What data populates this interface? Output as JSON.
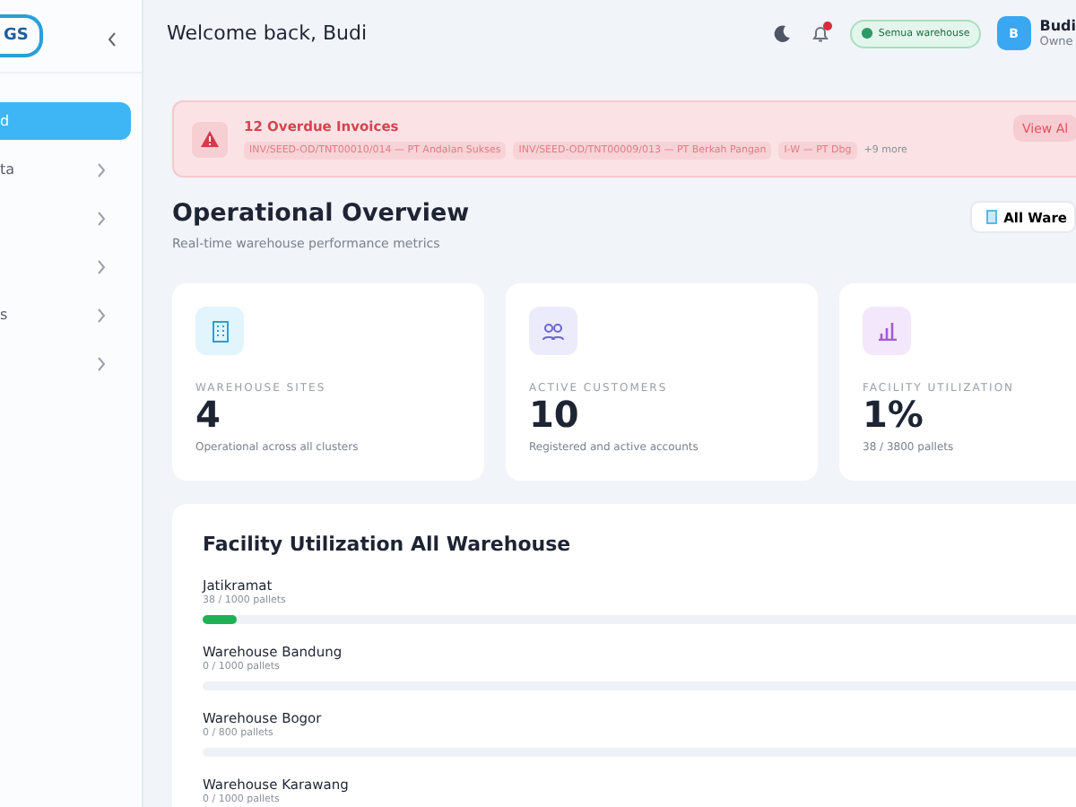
{
  "sidebar": {
    "logo": "GS",
    "items": [
      {
        "label": "d",
        "selected": true,
        "has_submenu": false
      },
      {
        "label": "ta",
        "selected": false,
        "has_submenu": true
      },
      {
        "selected": false,
        "has_submenu": true
      },
      {
        "selected": false,
        "has_submenu": true
      },
      {
        "label": "s",
        "selected": false,
        "has_submenu": true
      },
      {
        "selected": false,
        "has_submenu": true
      }
    ]
  },
  "header": {
    "greeting": "Welcome back, Budi",
    "notification_unread": true,
    "warehouse_filter": "Semua warehouse",
    "user": {
      "initial": "B",
      "name": "Budi",
      "role": "Owne"
    }
  },
  "alert": {
    "title": "12 Overdue Invoices",
    "invoices": [
      "INV/SEED-OD/TNT00010/014 — PT Andalan Sukses",
      "INV/SEED-OD/TNT00009/013 — PT Berkah Pangan",
      "I-W — PT Dbg"
    ],
    "more": "+9 more",
    "action": "View Al"
  },
  "overview": {
    "title": "Operational Overview",
    "subtitle": "Real-time warehouse performance metrics",
    "filter": "All Ware"
  },
  "stats": [
    {
      "kind": "building",
      "label": "WAREHOUSE SITES",
      "value": "4",
      "note": "Operational across all clusters"
    },
    {
      "kind": "users",
      "label": "ACTIVE CUSTOMERS",
      "value": "10",
      "note": "Registered and active accounts"
    },
    {
      "kind": "chart",
      "label": "FACILITY UTILIZATION",
      "value": "1%",
      "note": "38 / 3800 pallets"
    }
  ],
  "utilization": {
    "title": "Facility Utilization All Warehouse",
    "rows": [
      {
        "name": "Jatikramat",
        "capacity": "38 / 1000 pallets",
        "level": 0.038
      },
      {
        "name": "Warehouse Bandung",
        "capacity": "0 / 1000 pallets",
        "level": 0
      },
      {
        "name": "Warehouse Bogor",
        "capacity": "0 / 800 pallets",
        "level": 0
      },
      {
        "name": "Warehouse Karawang",
        "capacity": "0 / 1000 pallets"
      }
    ]
  }
}
